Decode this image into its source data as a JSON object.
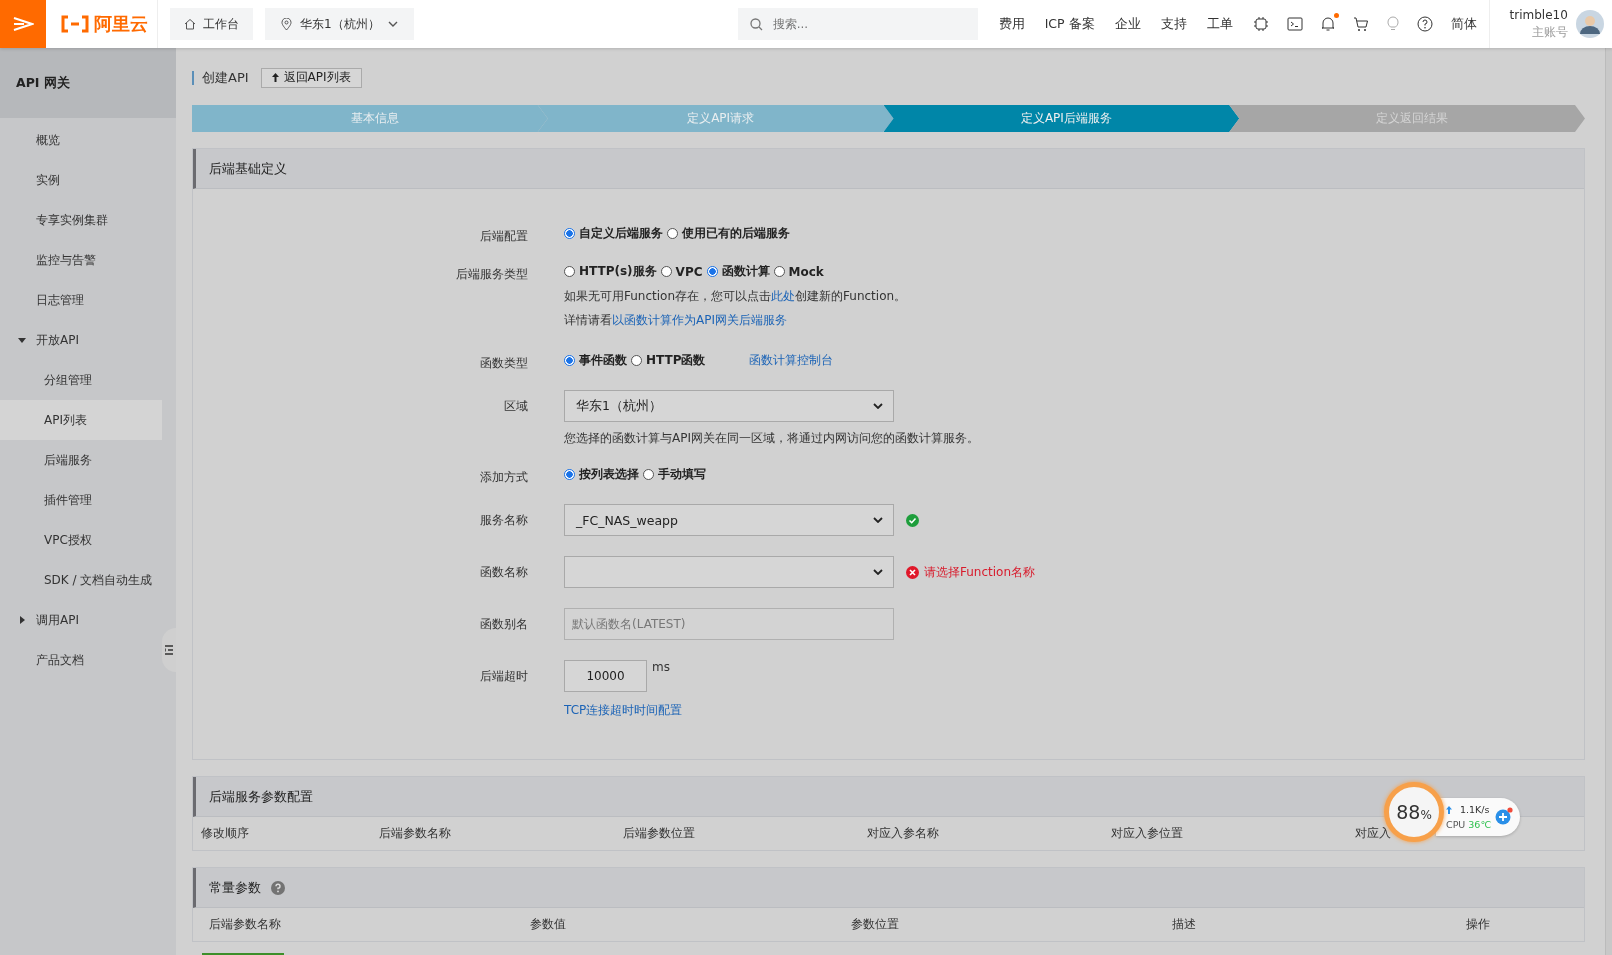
{
  "topbar": {
    "logo": "阿里云",
    "workbench": "工作台",
    "region": "华东1（杭州）",
    "search": {
      "placeholder": "搜索..."
    },
    "nav": [
      "费用",
      "ICP 备案",
      "企业",
      "支持",
      "工单"
    ],
    "notification_dot": true,
    "language": "简体",
    "user": {
      "name": "trimble10",
      "role": "主账号"
    }
  },
  "sidebar": {
    "title": "API 网关",
    "items": [
      {
        "label": "概览",
        "selected": false
      },
      {
        "label": "实例",
        "selected": false
      },
      {
        "label": "专享实例集群",
        "selected": false
      },
      {
        "label": "监控与告警",
        "selected": false
      },
      {
        "label": "日志管理",
        "selected": false
      },
      {
        "label": "开放API",
        "selected": false,
        "expanded": true,
        "children": [
          {
            "label": "分组管理",
            "selected": false
          },
          {
            "label": "API列表",
            "selected": true
          },
          {
            "label": "后端服务",
            "selected": false
          },
          {
            "label": "插件管理",
            "selected": false
          },
          {
            "label": "VPC授权",
            "selected": false
          },
          {
            "label": "SDK / 文档自动生成",
            "selected": false
          }
        ]
      },
      {
        "label": "调用API",
        "selected": false,
        "expanded": false
      },
      {
        "label": "产品文档",
        "selected": false
      }
    ]
  },
  "page": {
    "title": "创建API",
    "back_button": "返回API列表"
  },
  "steps": [
    {
      "label": "基本信息",
      "completed": true,
      "selected": false
    },
    {
      "label": "定义API请求",
      "completed": true,
      "selected": false
    },
    {
      "label": "定义API后端服务",
      "selected": true
    },
    {
      "label": "定义返回结果",
      "completed": false,
      "selected": false
    }
  ],
  "backend_section": {
    "title": "后端基础定义",
    "fields": [
      {
        "kind": "radio",
        "label": "后端配置",
        "options": [
          {
            "label": "自定义后端服务",
            "selected": true
          },
          {
            "label": "使用已有的后端服务",
            "selected": false
          }
        ]
      },
      {
        "kind": "radio",
        "label": "后端服务类型",
        "options": [
          {
            "label": "HTTP(s)服务",
            "selected": false
          },
          {
            "label": "VPC",
            "selected": false
          },
          {
            "label": "函数计算",
            "selected": true
          },
          {
            "label": "Mock",
            "selected": false
          }
        ],
        "notes": [
          [
            {
              "text": "如果无可用Function存在，您可以点击",
              "link": false
            },
            {
              "text": "此处",
              "link": true
            },
            {
              "text": "创建新的Function。",
              "link": false
            }
          ],
          [
            {
              "text": "详情请看",
              "link": false
            },
            {
              "text": "以函数计算作为API网关后端服务",
              "link": true
            }
          ]
        ]
      },
      {
        "kind": "radio",
        "label": "函数类型",
        "options": [
          {
            "label": "事件函数",
            "selected": true
          },
          {
            "label": "HTTP函数",
            "selected": false
          }
        ],
        "link": "函数计算控制台"
      },
      {
        "kind": "select",
        "label": "区域",
        "value": "华东1（杭州）",
        "notes": [
          [
            {
              "text": "您选择的函数计算与API网关在同一区域，将通过内网访问您的函数计算服务。",
              "link": false
            }
          ]
        ]
      },
      {
        "kind": "radio",
        "label": "添加方式",
        "options": [
          {
            "label": "按列表选择",
            "selected": true
          },
          {
            "label": "手动填写",
            "selected": false
          }
        ]
      },
      {
        "kind": "select",
        "label": "服务名称",
        "value": "_FC_NAS_weapp",
        "valid": true
      },
      {
        "kind": "select",
        "label": "函数名称",
        "valid": false,
        "message": "请选择Function名称"
      },
      {
        "kind": "input",
        "label": "函数别名",
        "placeholder": "默认函数名(LATEST)"
      },
      {
        "kind": "timeout",
        "label": "后端超时",
        "value": "10000",
        "unit": "ms",
        "link": "TCP连接超时时间配置"
      }
    ]
  },
  "params_section": {
    "title": "后端服务参数配置",
    "columns": [
      "修改顺序",
      "后端参数名称",
      "后端参数位置",
      "对应入参名称",
      "对应入参位置",
      "对应入"
    ]
  },
  "constants_section": {
    "title": "常量参数",
    "help": true,
    "columns": [
      "后端参数名称",
      "参数值",
      "参数位置",
      "描述",
      "操作"
    ]
  },
  "monitor_widget": {
    "percent": "88",
    "unit": "%",
    "speed": "1.1K/s",
    "cpu_label": "CPU",
    "temperature": "36℃"
  }
}
